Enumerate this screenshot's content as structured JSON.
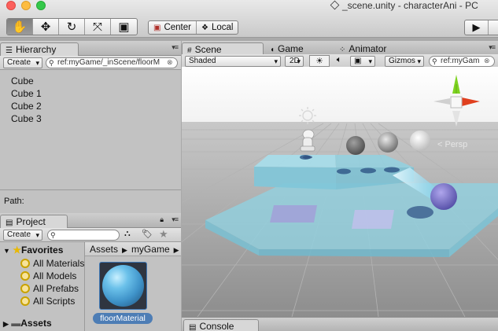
{
  "window": {
    "title": "_scene.unity - characterAni - PC"
  },
  "toolbar": {
    "transform_tools": [
      {
        "name": "hand-tool",
        "glyph": "✋"
      },
      {
        "name": "move-tool",
        "glyph": "✥"
      },
      {
        "name": "rotate-tool",
        "glyph": "↻"
      },
      {
        "name": "scale-tool",
        "glyph": "⤧"
      },
      {
        "name": "rect-tool",
        "glyph": "▣"
      }
    ],
    "pivot_label": "Center",
    "space_label": "Local",
    "play_glyph": "▶"
  },
  "hierarchy": {
    "tab": "Hierarchy",
    "create": "Create",
    "search_value": "ref:myGame/_inScene/floorM",
    "items": [
      "Cube",
      "Cube 1",
      "Cube 2",
      "Cube 3"
    ],
    "path_label": "Path:"
  },
  "project": {
    "tab": "Project",
    "create": "Create",
    "favorites_label": "Favorites",
    "favorites": [
      "All Materials",
      "All Models",
      "All Prefabs",
      "All Scripts"
    ],
    "assets_label": "Assets",
    "breadcrumb": [
      "Assets",
      "myGame"
    ],
    "asset": {
      "name": "floorMaterial"
    }
  },
  "scene": {
    "tabs": [
      "Scene",
      "Game",
      "Animator"
    ],
    "shading_mode": "Shaded",
    "mode_2d": "2D",
    "gizmos": "Gizmos",
    "search_value": "ref:myGam",
    "persp_label": "< Persp"
  },
  "console": {
    "tab": "Console"
  },
  "colors": {
    "selection_blue": "#4d7db5",
    "platform_cyan": "#8fd3e3",
    "axis_y": "#7ed321",
    "axis_x": "#e0401f"
  }
}
